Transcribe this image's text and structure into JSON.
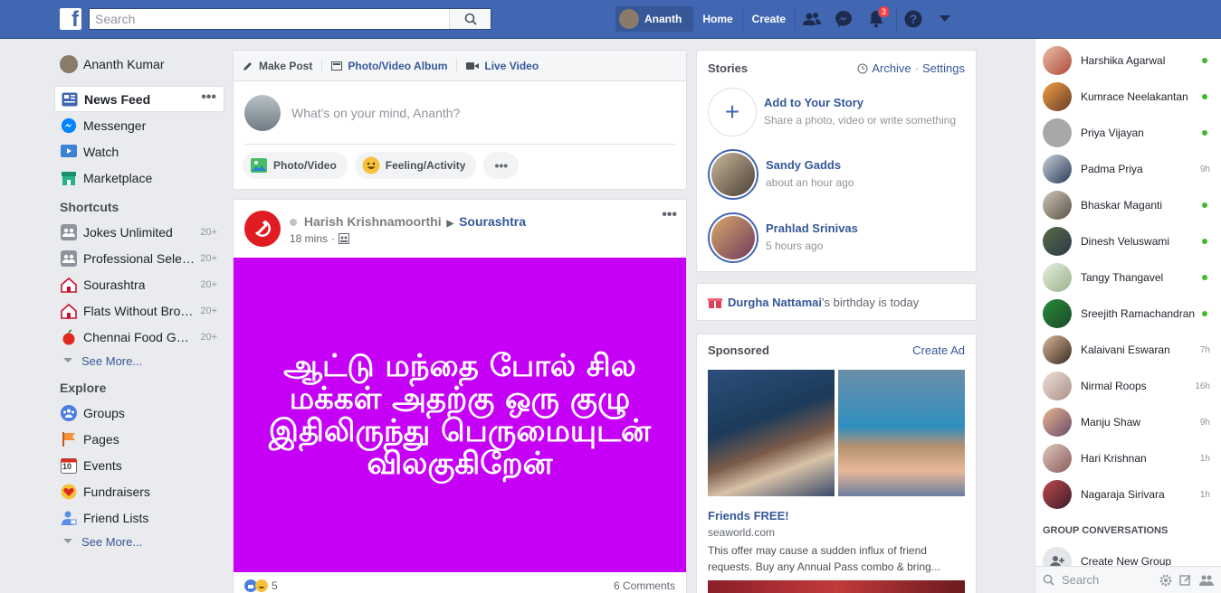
{
  "topbar": {
    "logo": "f",
    "search_placeholder": "Search",
    "user_name": "Ananth",
    "nav": [
      "Home",
      "Create"
    ],
    "notifications_count": "3",
    "brand_color": "#4267b2"
  },
  "leftnav": {
    "profile": "Ananth Kumar",
    "main": [
      {
        "label": "News Feed",
        "icon": "news-feed-icon"
      },
      {
        "label": "Messenger",
        "icon": "messenger-icon"
      },
      {
        "label": "Watch",
        "icon": "watch-icon"
      },
      {
        "label": "Marketplace",
        "icon": "marketplace-icon"
      }
    ],
    "shortcuts_title": "Shortcuts",
    "shortcuts": [
      {
        "label": "Jokes Unlimited",
        "count": "20+"
      },
      {
        "label": "Professional Selenium...",
        "count": "20+"
      },
      {
        "label": "Sourashtra",
        "count": "20+"
      },
      {
        "label": "Flats Without Broker...",
        "count": "20+"
      },
      {
        "label": "Chennai Food Guide",
        "count": "20+"
      }
    ],
    "see_more": "See More...",
    "explore_title": "Explore",
    "explore": [
      "Groups",
      "Pages",
      "Events",
      "Fundraisers",
      "Friend Lists"
    ],
    "events_day": "10"
  },
  "composer": {
    "tabs": [
      "Make Post",
      "Photo/Video Album",
      "Live Video"
    ],
    "placeholder": "What's on your mind, Ananth?",
    "actions": [
      "Photo/Video",
      "Feeling/Activity"
    ]
  },
  "post": {
    "author": "Harish Krishnamoorthi",
    "group": "Sourashtra",
    "time": "18 mins",
    "text": "ஆட்டு மந்தை போல் சில மக்கள் அதற்கு ஒரு குழு இதிலிருந்து பெருமையுடன் விலகுகிறேன்",
    "reactions": "5",
    "comments": "6 Comments",
    "image_color": "#c600f7"
  },
  "stories": {
    "title": "Stories",
    "archive": "Archive",
    "settings": "Settings",
    "add_title": "Add to Your Story",
    "add_sub": "Share a photo, video or write something",
    "items": [
      {
        "name": "Sandy Gadds",
        "time": "about an hour ago"
      },
      {
        "name": "Prahlad Srinivas",
        "time": "5 hours ago"
      }
    ]
  },
  "birthday": {
    "name": "Durgha Nattamai",
    "text": "'s birthday is today"
  },
  "sponsored": {
    "title": "Sponsored",
    "create_ad": "Create Ad",
    "ad_title": "Friends FREE!",
    "ad_site": "seaworld.com",
    "ad_desc": "This offer may cause a sudden influx of friend requests. Buy any Annual Pass combo & bring..."
  },
  "chat": {
    "contacts": [
      {
        "name": "Harshika Agarwal",
        "status": "online"
      },
      {
        "name": "Kumrace Neelakantan",
        "status": "online"
      },
      {
        "name": "Priya Vijayan",
        "status": "online"
      },
      {
        "name": "Padma Priya",
        "status": "9h"
      },
      {
        "name": "Bhaskar Maganti",
        "status": "online"
      },
      {
        "name": "Dinesh Veluswami",
        "status": "online"
      },
      {
        "name": "Tangy Thangavel",
        "status": "online"
      },
      {
        "name": "Sreejith Ramachandran",
        "status": "online"
      },
      {
        "name": "Kalaivani Eswaran",
        "status": "7h"
      },
      {
        "name": "Nirmal Roops",
        "status": "16h"
      },
      {
        "name": "Manju Shaw",
        "status": "9h"
      },
      {
        "name": "Hari Krishnan",
        "status": "1h"
      },
      {
        "name": "Nagaraja Sirivara",
        "status": "1h"
      }
    ],
    "group_title": "GROUP CONVERSATIONS",
    "create_group": "Create New Group",
    "search_placeholder": "Search"
  }
}
